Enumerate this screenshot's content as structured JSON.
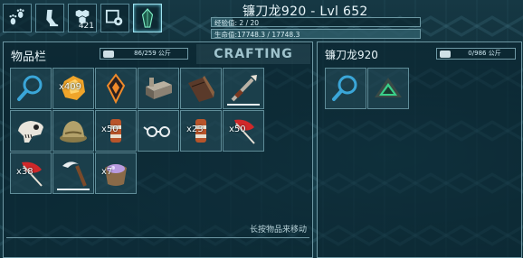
{
  "header": {
    "title": "镰刀龙920 - Lvl 652",
    "xp_text": "经验值: 2 / 20",
    "xp_fraction": 0.1,
    "hp_text": "生命值:17748.3 / 17748.3",
    "hp_fraction": 1.0,
    "tab_icons": [
      "paw-tracks-icon",
      "dino-leg-icon",
      "engram-hexes-icon",
      "tame-settings-icon",
      "tek-crystal-icon"
    ],
    "engram_count": "421"
  },
  "inventory": {
    "title": "物品栏",
    "weight": "86/259 公斤",
    "crafting_label": "CRAFTING",
    "hint": "长按物品来移动",
    "slots": [
      {
        "icon": "search-icon",
        "qty": ""
      },
      {
        "icon": "amber-icon",
        "qty": "x409"
      },
      {
        "icon": "orange-gem-icon",
        "qty": ""
      },
      {
        "icon": "bench-structure-icon",
        "qty": ""
      },
      {
        "icon": "wooden-ramp-icon",
        "qty": ""
      },
      {
        "icon": "harpoon-icon",
        "qty": ""
      },
      {
        "icon": "dino-skull-icon",
        "qty": ""
      },
      {
        "icon": "pith-helmet-icon",
        "qty": ""
      },
      {
        "icon": "leather-cup-icon",
        "qty": "x50"
      },
      {
        "icon": "glasses-icon",
        "qty": ""
      },
      {
        "icon": "leather-cup-icon",
        "qty": "x23"
      },
      {
        "icon": "red-feather-icon",
        "qty": "x50"
      },
      {
        "icon": "red-feather-icon",
        "qty": "x38"
      },
      {
        "icon": "sickle-icon",
        "qty": ""
      },
      {
        "icon": "crystal-bag-icon",
        "qty": "x7"
      }
    ]
  },
  "dino_panel": {
    "title": "镰刀龙920",
    "weight": "0/986 公斤",
    "slots": [
      {
        "icon": "search-icon"
      },
      {
        "icon": "green-triangle-icon"
      }
    ]
  }
}
